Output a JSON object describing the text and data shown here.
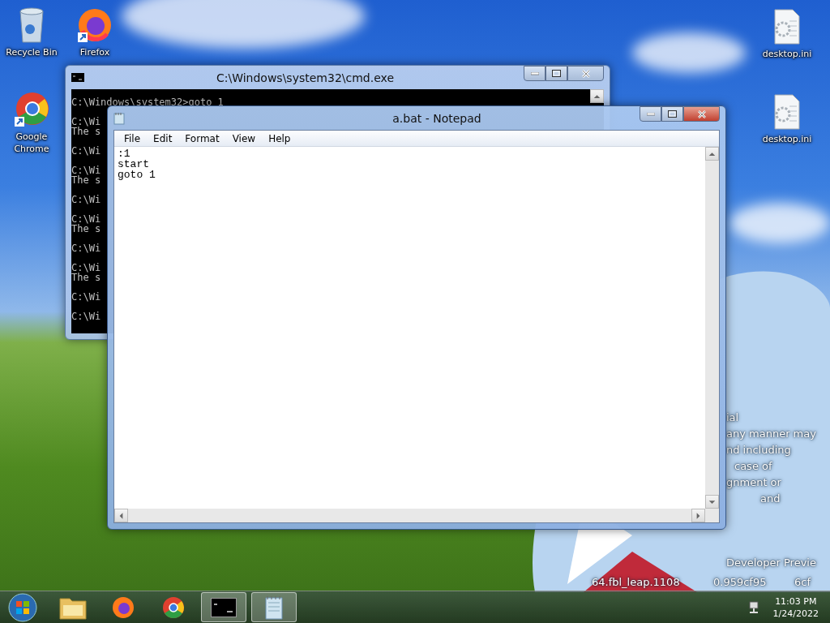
{
  "desktop_icons": [
    {
      "label": "Recycle Bin",
      "kind": "bin"
    },
    {
      "label": "Firefox",
      "kind": "firefox"
    },
    {
      "label": "desktop.ini",
      "kind": "ini"
    },
    {
      "label": "Google Chrome",
      "kind": "chrome"
    },
    {
      "label": "desktop.ini",
      "kind": "ini"
    }
  ],
  "wallpaper_text": [
    "ial",
    "any manner may",
    "nd including",
    "case of",
    "gnment or",
    "and",
    "Developer Previe",
    "64.fbl_leap.1108",
    "0.959cf95",
    "6cf"
  ],
  "cmd_window": {
    "title": "C:\\Windows\\system32\\cmd.exe",
    "blocks": [
      [
        "C:\\Windows\\system32>goto 1"
      ],
      [
        "C:\\Wi",
        "The s"
      ],
      [
        "C:\\Wi"
      ],
      [
        "C:\\Wi",
        "The s"
      ],
      [
        "C:\\Wi"
      ],
      [
        "C:\\Wi",
        "The s"
      ],
      [
        "C:\\Wi"
      ],
      [
        "C:\\Wi",
        "The s"
      ],
      [
        "C:\\Wi"
      ],
      [
        "C:\\Wi"
      ]
    ]
  },
  "notepad": {
    "title": "a.bat - Notepad",
    "menu": [
      "File",
      "Edit",
      "Format",
      "View",
      "Help"
    ],
    "lines": [
      ":1",
      "start",
      "goto 1"
    ]
  },
  "taskbar": {
    "items": [
      {
        "kind": "explorer",
        "open": false
      },
      {
        "kind": "firefox",
        "open": false
      },
      {
        "kind": "chrome",
        "open": false
      },
      {
        "kind": "cmd",
        "open": true
      },
      {
        "kind": "notepad",
        "open": true
      }
    ],
    "time": "11:03 PM",
    "date": "1/24/2022"
  }
}
